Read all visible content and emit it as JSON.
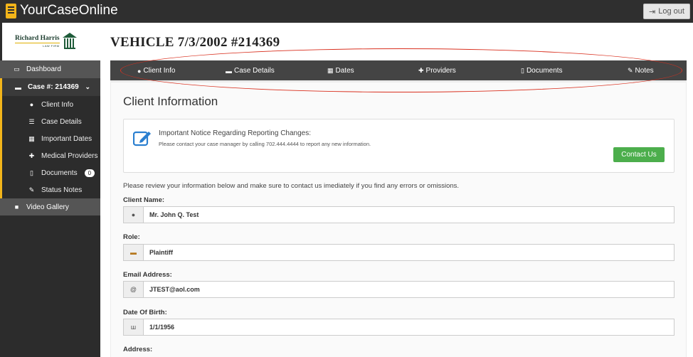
{
  "app": {
    "title": "YourCaseOnline",
    "logout_label": "Log out"
  },
  "logo": {
    "name": "Richard Harris",
    "sub": "LAW FIRM"
  },
  "sidebar": {
    "dashboard": "Dashboard",
    "case": "Case #: 214369",
    "items": [
      {
        "label": "Client Info",
        "icon": "user-icon"
      },
      {
        "label": "Case Details",
        "icon": "list-icon"
      },
      {
        "label": "Important Dates",
        "icon": "calendar-icon"
      },
      {
        "label": "Medical Providers",
        "icon": "medkit-icon"
      },
      {
        "label": "Documents",
        "icon": "document-icon",
        "badge": "0"
      },
      {
        "label": "Status Notes",
        "icon": "pencil-icon"
      }
    ],
    "video": "Video Gallery"
  },
  "page": {
    "title": "VEHICLE 7/3/2002 #214369"
  },
  "tabs": [
    {
      "label": "Client Info",
      "icon": "user-icon"
    },
    {
      "label": "Case Details",
      "icon": "briefcase-icon"
    },
    {
      "label": "Dates",
      "icon": "calendar-icon"
    },
    {
      "label": "Providers",
      "icon": "medkit-icon"
    },
    {
      "label": "Documents",
      "icon": "document-icon"
    },
    {
      "label": "Notes",
      "icon": "pencil-icon"
    }
  ],
  "client_info": {
    "section_title": "Client Information",
    "notice_title": "Important Notice Regarding Reporting Changes:",
    "notice_text": "Please contact your case manager by calling 702.444.4444 to report any new information.",
    "contact_label": "Contact Us",
    "intro": "Please review your information below and make sure to contact us imediately if you find any errors or omissions.",
    "fields": [
      {
        "label": "Client Name:",
        "value": "Mr. John Q. Test",
        "icon": "user-icon"
      },
      {
        "label": "Role:",
        "value": "Plaintiff",
        "icon": "briefcase-icon"
      },
      {
        "label": "Email Address:",
        "value": "JTEST@aol.com",
        "icon": "at-icon"
      },
      {
        "label": "Date Of Birth:",
        "value": "1/1/1956",
        "icon": "birthday-cake-icon"
      },
      {
        "label": "Address:",
        "value": "",
        "icon": "home-icon"
      }
    ]
  },
  "colors": {
    "accent": "#f3b51a",
    "topbar": "#2f2f2f",
    "tabbar": "#444444",
    "button_green": "#4cae4c",
    "annotation_red": "#d9301f"
  }
}
